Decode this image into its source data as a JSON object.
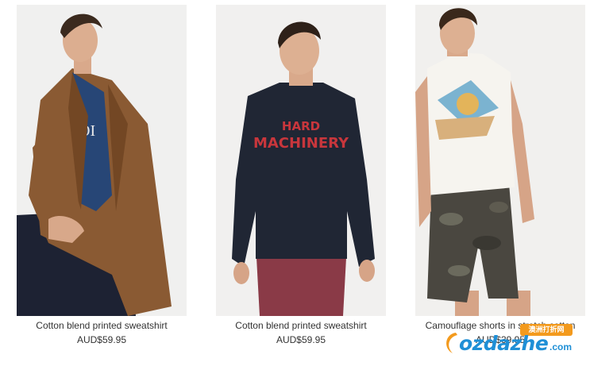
{
  "products": [
    {
      "name": "Cotton blend printed sweatshirt",
      "price": "AUD$59.95"
    },
    {
      "name": "Cotton blend printed sweatshirt",
      "price": "AUD$59.95"
    },
    {
      "name": "Camouflage shorts in stretch cotton",
      "price": "AUD$39.95"
    }
  ],
  "artwork": {
    "sweatshirt_print_line1": "HARD",
    "sweatshirt_print_line2": "MACHINERY"
  },
  "watermark": {
    "brand": "ozdazhe",
    "domain": ".com",
    "badge": "澳洲打折网"
  },
  "colors": {
    "text": "#333333",
    "image_bg": "#f2f2f2",
    "watermark_blue": "#1f8fd6",
    "watermark_orange": "#f39a1d"
  }
}
